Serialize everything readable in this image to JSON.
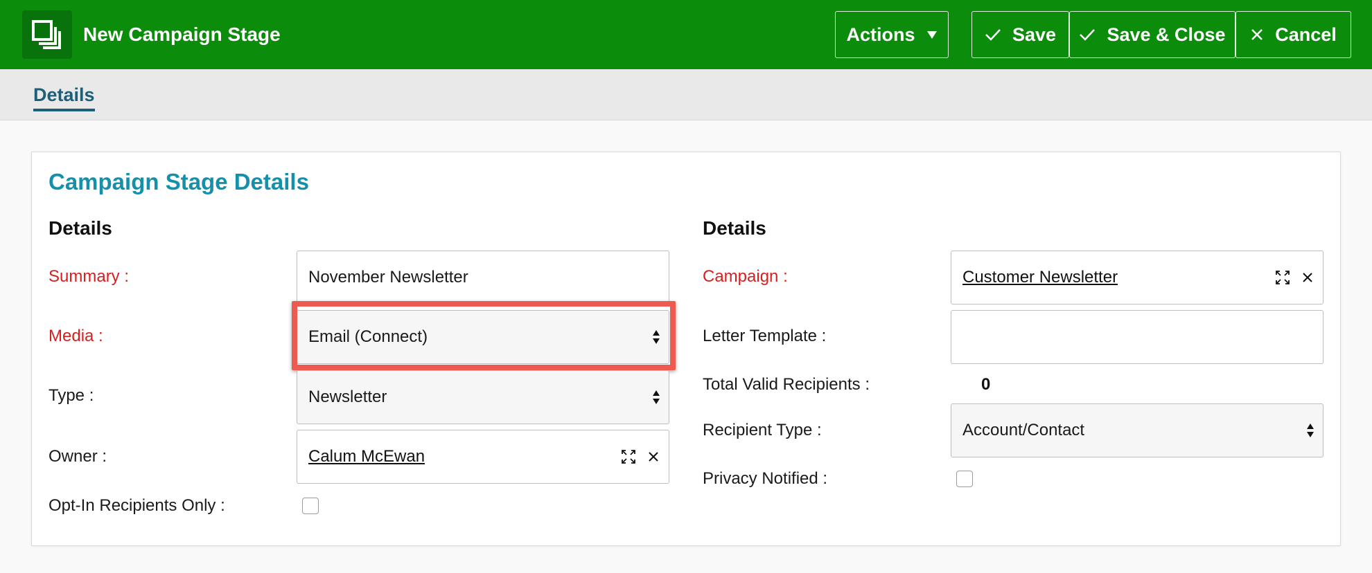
{
  "header": {
    "title": "New Campaign Stage",
    "actions_label": "Actions",
    "save_label": "Save",
    "save_close_label": "Save & Close",
    "cancel_label": "Cancel",
    "bg_color": "#0b8c0b"
  },
  "tabs": [
    {
      "label": "Details",
      "active": true
    }
  ],
  "panel": {
    "title": "Campaign Stage Details",
    "left": {
      "section": "Details",
      "summary": {
        "label": "Summary :",
        "value": "November Newsletter"
      },
      "media": {
        "label": "Media :",
        "value": "Email (Connect)"
      },
      "type": {
        "label": "Type :",
        "value": "Newsletter"
      },
      "owner": {
        "label": "Owner :",
        "value": "Calum McEwan"
      },
      "opt_in": {
        "label": "Opt-In Recipients Only :",
        "checked": false
      }
    },
    "right": {
      "section": "Details",
      "campaign": {
        "label": "Campaign :",
        "value": "Customer Newsletter"
      },
      "letter_template": {
        "label": "Letter Template :",
        "value": ""
      },
      "total_valid_recipients": {
        "label": "Total Valid Recipients :",
        "value": "0"
      },
      "recipient_type": {
        "label": "Recipient Type :",
        "value": "Account/Contact"
      },
      "privacy_notified": {
        "label": "Privacy Notified :",
        "checked": false
      }
    }
  },
  "colors": {
    "accent": "#1590ab",
    "required": "#d62020",
    "highlight": "#ee5a4f"
  }
}
